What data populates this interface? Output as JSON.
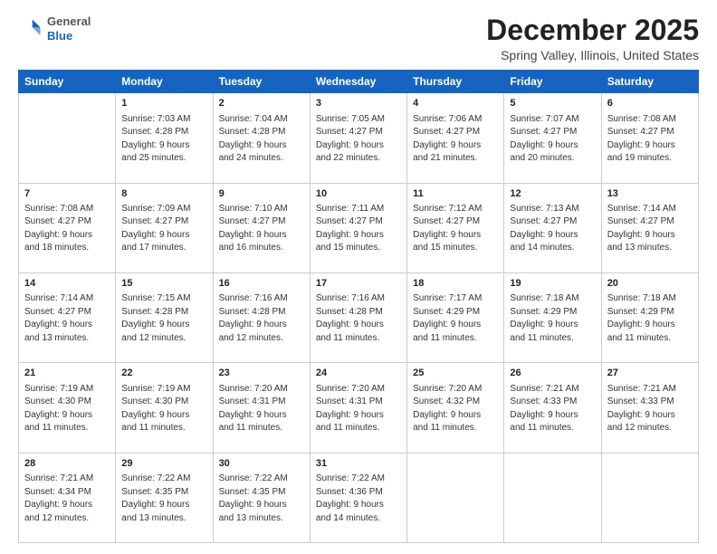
{
  "header": {
    "logo_line1": "General",
    "logo_line2": "Blue",
    "month_title": "December 2025",
    "location": "Spring Valley, Illinois, United States"
  },
  "weekdays": [
    "Sunday",
    "Monday",
    "Tuesday",
    "Wednesday",
    "Thursday",
    "Friday",
    "Saturday"
  ],
  "weeks": [
    [
      {
        "day": "",
        "sunrise": "",
        "sunset": "",
        "daylight": ""
      },
      {
        "day": "1",
        "sunrise": "Sunrise: 7:03 AM",
        "sunset": "Sunset: 4:28 PM",
        "daylight": "Daylight: 9 hours and 25 minutes."
      },
      {
        "day": "2",
        "sunrise": "Sunrise: 7:04 AM",
        "sunset": "Sunset: 4:28 PM",
        "daylight": "Daylight: 9 hours and 24 minutes."
      },
      {
        "day": "3",
        "sunrise": "Sunrise: 7:05 AM",
        "sunset": "Sunset: 4:27 PM",
        "daylight": "Daylight: 9 hours and 22 minutes."
      },
      {
        "day": "4",
        "sunrise": "Sunrise: 7:06 AM",
        "sunset": "Sunset: 4:27 PM",
        "daylight": "Daylight: 9 hours and 21 minutes."
      },
      {
        "day": "5",
        "sunrise": "Sunrise: 7:07 AM",
        "sunset": "Sunset: 4:27 PM",
        "daylight": "Daylight: 9 hours and 20 minutes."
      },
      {
        "day": "6",
        "sunrise": "Sunrise: 7:08 AM",
        "sunset": "Sunset: 4:27 PM",
        "daylight": "Daylight: 9 hours and 19 minutes."
      }
    ],
    [
      {
        "day": "7",
        "sunrise": "Sunrise: 7:08 AM",
        "sunset": "Sunset: 4:27 PM",
        "daylight": "Daylight: 9 hours and 18 minutes."
      },
      {
        "day": "8",
        "sunrise": "Sunrise: 7:09 AM",
        "sunset": "Sunset: 4:27 PM",
        "daylight": "Daylight: 9 hours and 17 minutes."
      },
      {
        "day": "9",
        "sunrise": "Sunrise: 7:10 AM",
        "sunset": "Sunset: 4:27 PM",
        "daylight": "Daylight: 9 hours and 16 minutes."
      },
      {
        "day": "10",
        "sunrise": "Sunrise: 7:11 AM",
        "sunset": "Sunset: 4:27 PM",
        "daylight": "Daylight: 9 hours and 15 minutes."
      },
      {
        "day": "11",
        "sunrise": "Sunrise: 7:12 AM",
        "sunset": "Sunset: 4:27 PM",
        "daylight": "Daylight: 9 hours and 15 minutes."
      },
      {
        "day": "12",
        "sunrise": "Sunrise: 7:13 AM",
        "sunset": "Sunset: 4:27 PM",
        "daylight": "Daylight: 9 hours and 14 minutes."
      },
      {
        "day": "13",
        "sunrise": "Sunrise: 7:14 AM",
        "sunset": "Sunset: 4:27 PM",
        "daylight": "Daylight: 9 hours and 13 minutes."
      }
    ],
    [
      {
        "day": "14",
        "sunrise": "Sunrise: 7:14 AM",
        "sunset": "Sunset: 4:27 PM",
        "daylight": "Daylight: 9 hours and 13 minutes."
      },
      {
        "day": "15",
        "sunrise": "Sunrise: 7:15 AM",
        "sunset": "Sunset: 4:28 PM",
        "daylight": "Daylight: 9 hours and 12 minutes."
      },
      {
        "day": "16",
        "sunrise": "Sunrise: 7:16 AM",
        "sunset": "Sunset: 4:28 PM",
        "daylight": "Daylight: 9 hours and 12 minutes."
      },
      {
        "day": "17",
        "sunrise": "Sunrise: 7:16 AM",
        "sunset": "Sunset: 4:28 PM",
        "daylight": "Daylight: 9 hours and 11 minutes."
      },
      {
        "day": "18",
        "sunrise": "Sunrise: 7:17 AM",
        "sunset": "Sunset: 4:29 PM",
        "daylight": "Daylight: 9 hours and 11 minutes."
      },
      {
        "day": "19",
        "sunrise": "Sunrise: 7:18 AM",
        "sunset": "Sunset: 4:29 PM",
        "daylight": "Daylight: 9 hours and 11 minutes."
      },
      {
        "day": "20",
        "sunrise": "Sunrise: 7:18 AM",
        "sunset": "Sunset: 4:29 PM",
        "daylight": "Daylight: 9 hours and 11 minutes."
      }
    ],
    [
      {
        "day": "21",
        "sunrise": "Sunrise: 7:19 AM",
        "sunset": "Sunset: 4:30 PM",
        "daylight": "Daylight: 9 hours and 11 minutes."
      },
      {
        "day": "22",
        "sunrise": "Sunrise: 7:19 AM",
        "sunset": "Sunset: 4:30 PM",
        "daylight": "Daylight: 9 hours and 11 minutes."
      },
      {
        "day": "23",
        "sunrise": "Sunrise: 7:20 AM",
        "sunset": "Sunset: 4:31 PM",
        "daylight": "Daylight: 9 hours and 11 minutes."
      },
      {
        "day": "24",
        "sunrise": "Sunrise: 7:20 AM",
        "sunset": "Sunset: 4:31 PM",
        "daylight": "Daylight: 9 hours and 11 minutes."
      },
      {
        "day": "25",
        "sunrise": "Sunrise: 7:20 AM",
        "sunset": "Sunset: 4:32 PM",
        "daylight": "Daylight: 9 hours and 11 minutes."
      },
      {
        "day": "26",
        "sunrise": "Sunrise: 7:21 AM",
        "sunset": "Sunset: 4:33 PM",
        "daylight": "Daylight: 9 hours and 11 minutes."
      },
      {
        "day": "27",
        "sunrise": "Sunrise: 7:21 AM",
        "sunset": "Sunset: 4:33 PM",
        "daylight": "Daylight: 9 hours and 12 minutes."
      }
    ],
    [
      {
        "day": "28",
        "sunrise": "Sunrise: 7:21 AM",
        "sunset": "Sunset: 4:34 PM",
        "daylight": "Daylight: 9 hours and 12 minutes."
      },
      {
        "day": "29",
        "sunrise": "Sunrise: 7:22 AM",
        "sunset": "Sunset: 4:35 PM",
        "daylight": "Daylight: 9 hours and 13 minutes."
      },
      {
        "day": "30",
        "sunrise": "Sunrise: 7:22 AM",
        "sunset": "Sunset: 4:35 PM",
        "daylight": "Daylight: 9 hours and 13 minutes."
      },
      {
        "day": "31",
        "sunrise": "Sunrise: 7:22 AM",
        "sunset": "Sunset: 4:36 PM",
        "daylight": "Daylight: 9 hours and 14 minutes."
      },
      {
        "day": "",
        "sunrise": "",
        "sunset": "",
        "daylight": ""
      },
      {
        "day": "",
        "sunrise": "",
        "sunset": "",
        "daylight": ""
      },
      {
        "day": "",
        "sunrise": "",
        "sunset": "",
        "daylight": ""
      }
    ]
  ]
}
